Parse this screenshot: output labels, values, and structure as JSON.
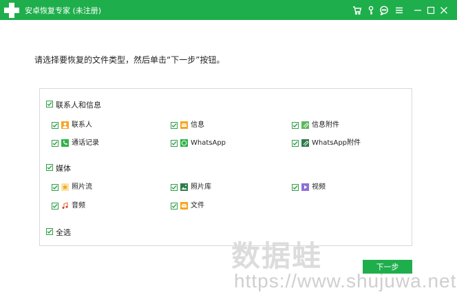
{
  "window": {
    "title": "安卓恢复专家 (未注册)",
    "icons": [
      "cart-icon",
      "key-icon",
      "chat-icon",
      "menu-icon",
      "minimize-icon",
      "maximize-icon",
      "close-icon"
    ]
  },
  "instruction": "请选择要恢复的文件类型，然后单击“下一步”按钮。",
  "groups": {
    "contacts": {
      "label": "联系人和信息",
      "items": {
        "contacts": "联系人",
        "messages": "信息",
        "message_attachments": "信息附件",
        "call_logs": "通话记录",
        "whatsapp": "WhatsApp",
        "whatsapp_attachments": "WhatsApp附件"
      }
    },
    "media": {
      "label": "媒体",
      "items": {
        "gallery": "照片流",
        "picture_library": "照片库",
        "videos": "视频",
        "audio": "音频",
        "documents": "文件"
      }
    }
  },
  "select_all": "全选",
  "next_button": "下一步",
  "watermark": {
    "name": "数据蛙",
    "url": "https://www.shujuwa.net"
  },
  "colors": {
    "accent": "#1fae4c",
    "checkbox": "#2f9e47"
  }
}
